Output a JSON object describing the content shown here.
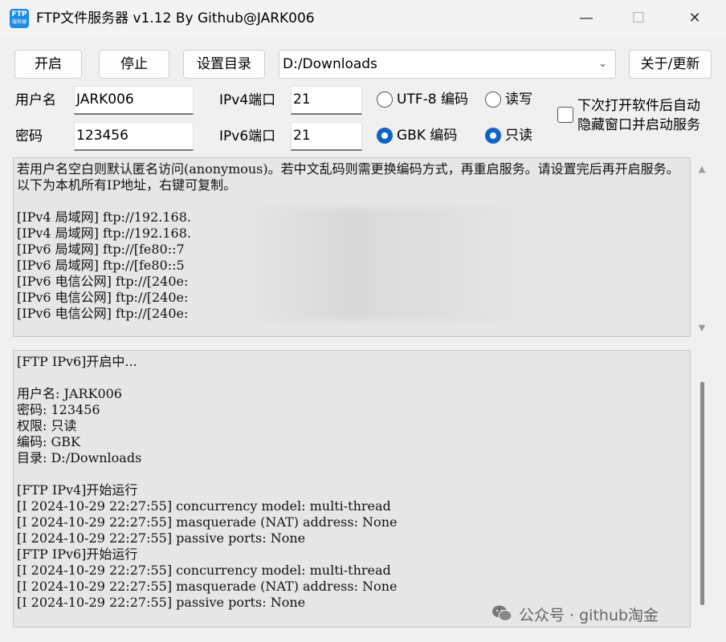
{
  "window": {
    "title": "FTP文件服务器 v1.12 By Github@JARK006",
    "app_icon": {
      "line1": "FTP",
      "line2": "服务器"
    },
    "controls": {
      "minimize": "—",
      "maximize": "☐",
      "close": "✕"
    }
  },
  "toolbar": {
    "start": "开启",
    "stop": "停止",
    "set_dir": "设置目录",
    "directory": "D:/Downloads",
    "about": "关于/更新"
  },
  "form": {
    "username_label": "用户名",
    "username_value": "JARK006",
    "password_label": "密码",
    "password_value": "123456",
    "ipv4_port_label": "IPv4端口",
    "ipv4_port_value": "21",
    "ipv6_port_label": "IPv6端口",
    "ipv6_port_value": "21",
    "encoding_utf8": "UTF-8 编码",
    "encoding_gbk": "GBK 编码",
    "perm_rw": "读写",
    "perm_ro": "只读",
    "autostart_line1": "下次打开软件后自动",
    "autostart_line2": "隐藏窗口并启动服务",
    "selected_encoding": "GBK 编码",
    "selected_permission": "只读",
    "autostart_checked": false
  },
  "info_panel": {
    "notice": "若用户名空白则默认匿名访问(anonymous)。若中文乱码则需更换编码方式，再重启服务。请设置完后再开启服务。以下为本机所有IP地址，右键可复制。",
    "addresses": [
      "[IPv4 局域网] ftp://192.168.",
      "[IPv4 局域网] ftp://192.168.",
      "[IPv6 局域网] ftp://[fe80::7",
      "[IPv6 局域网] ftp://[fe80::5",
      "[IPv6 电信公网] ftp://[240e:",
      "[IPv6 电信公网] ftp://[240e:",
      "[IPv6 电信公网] ftp://[240e:"
    ]
  },
  "log_panel": {
    "lines": [
      "[FTP IPv6]开启中...",
      "",
      "用户名: JARK006",
      "密码: 123456",
      "权限: 只读",
      "编码: GBK",
      "目录: D:/Downloads",
      "",
      "[FTP IPv4]开始运行",
      "[I 2024-10-29 22:27:55] concurrency model: multi-thread",
      "[I 2024-10-29 22:27:55] masquerade (NAT) address: None",
      "[I 2024-10-29 22:27:55] passive ports: None",
      "[FTP IPv6]开始运行",
      "[I 2024-10-29 22:27:55] concurrency model: multi-thread",
      "[I 2024-10-29 22:27:55] masquerade (NAT) address: None",
      "[I 2024-10-29 22:27:55] passive ports: None"
    ]
  },
  "watermark": "公众号 · github淘金",
  "colors": {
    "accent": "#1164c4",
    "panel_bg": "#e6e6e6",
    "window_bg": "#f0f0f0"
  }
}
